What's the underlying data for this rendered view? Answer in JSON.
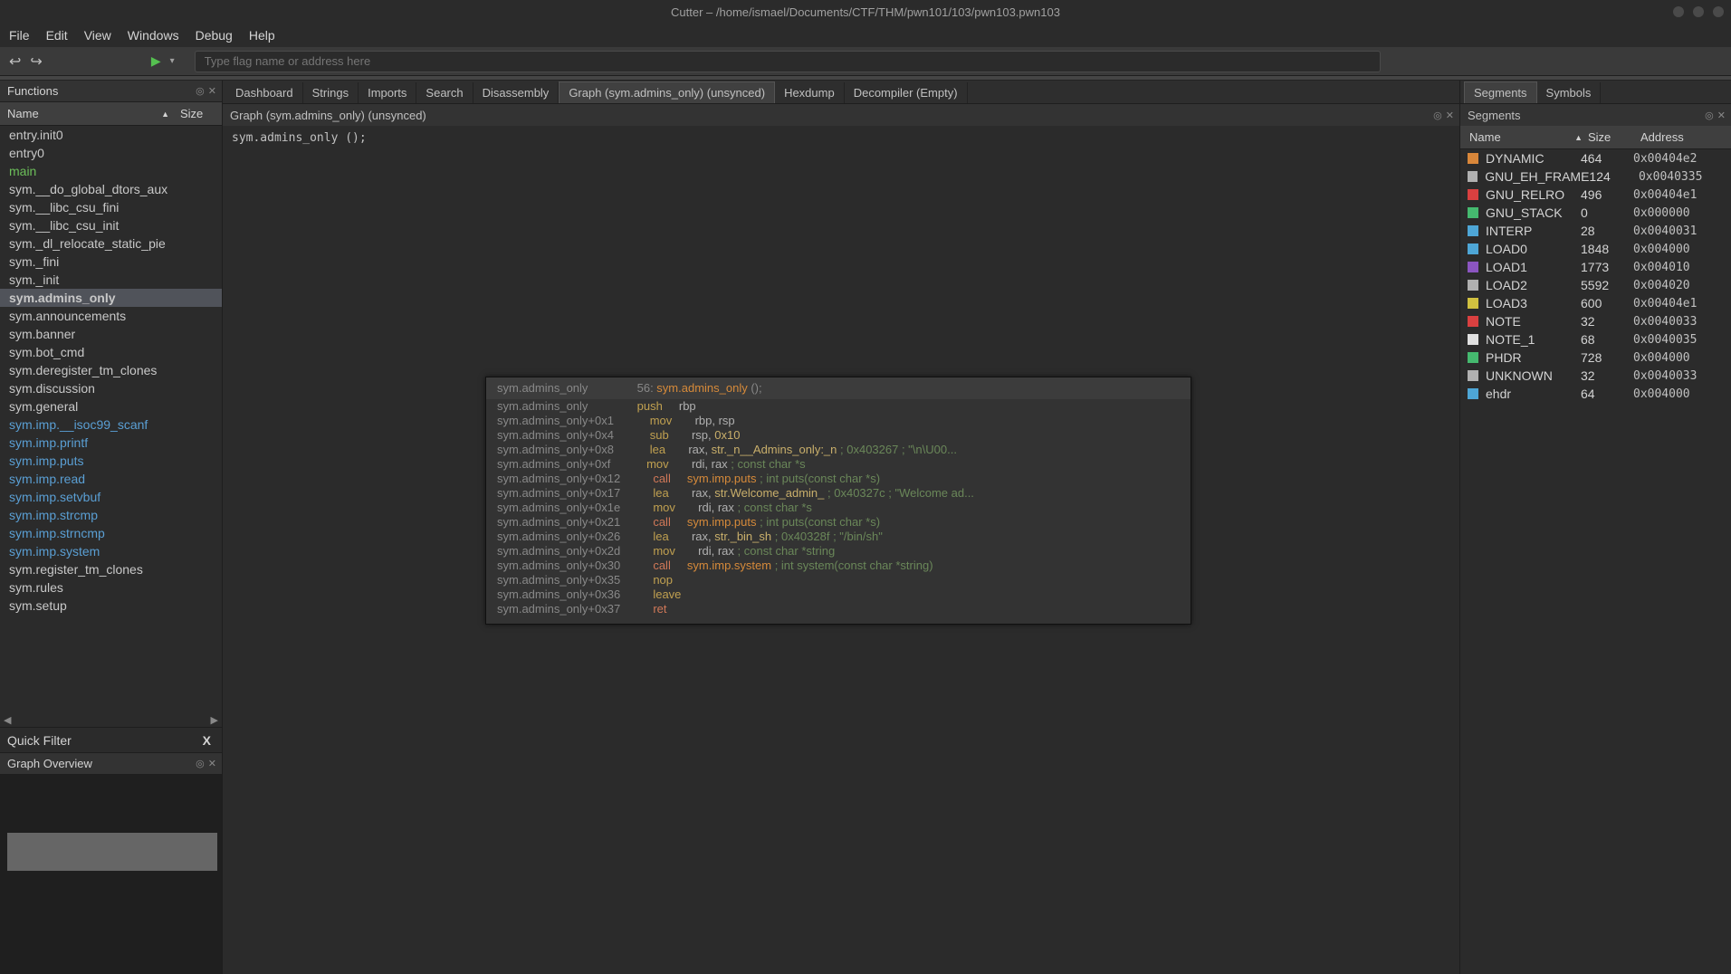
{
  "title": "Cutter – /home/ismael/Documents/CTF/THM/pwn101/103/pwn103.pwn103",
  "menu": {
    "file": "File",
    "edit": "Edit",
    "view": "View",
    "windows": "Windows",
    "debug": "Debug",
    "help": "Help"
  },
  "toolbar": {
    "search_placeholder": "Type flag name or address here"
  },
  "left": {
    "title": "Functions",
    "col_name": "Name",
    "col_size": "Size",
    "quick_filter": "Quick Filter",
    "graph_ov": "Graph Overview",
    "items": [
      {
        "label": "entry.init0",
        "style": ""
      },
      {
        "label": "entry0",
        "style": ""
      },
      {
        "label": "main",
        "style": "green"
      },
      {
        "label": "sym.__do_global_dtors_aux",
        "style": ""
      },
      {
        "label": "sym.__libc_csu_fini",
        "style": ""
      },
      {
        "label": "sym.__libc_csu_init",
        "style": ""
      },
      {
        "label": "sym._dl_relocate_static_pie",
        "style": ""
      },
      {
        "label": "sym._fini",
        "style": ""
      },
      {
        "label": "sym._init",
        "style": ""
      },
      {
        "label": "sym.admins_only",
        "style": "selected"
      },
      {
        "label": "sym.announcements",
        "style": ""
      },
      {
        "label": "sym.banner",
        "style": ""
      },
      {
        "label": "sym.bot_cmd",
        "style": ""
      },
      {
        "label": "sym.deregister_tm_clones",
        "style": ""
      },
      {
        "label": "sym.discussion",
        "style": ""
      },
      {
        "label": "sym.general",
        "style": ""
      },
      {
        "label": "sym.imp.__isoc99_scanf",
        "style": "blue"
      },
      {
        "label": "sym.imp.printf",
        "style": "blue"
      },
      {
        "label": "sym.imp.puts",
        "style": "blue"
      },
      {
        "label": "sym.imp.read",
        "style": "blue"
      },
      {
        "label": "sym.imp.setvbuf",
        "style": "blue"
      },
      {
        "label": "sym.imp.strcmp",
        "style": "blue"
      },
      {
        "label": "sym.imp.strncmp",
        "style": "blue"
      },
      {
        "label": "sym.imp.system",
        "style": "blue"
      },
      {
        "label": "sym.register_tm_clones",
        "style": ""
      },
      {
        "label": "sym.rules",
        "style": ""
      },
      {
        "label": "sym.setup",
        "style": ""
      }
    ]
  },
  "center": {
    "tabs": [
      {
        "label": "Dashboard",
        "active": false
      },
      {
        "label": "Strings",
        "active": false
      },
      {
        "label": "Imports",
        "active": false
      },
      {
        "label": "Search",
        "active": false
      },
      {
        "label": "Disassembly",
        "active": false
      },
      {
        "label": "Graph (sym.admins_only) (unsynced)",
        "active": true
      },
      {
        "label": "Hexdump",
        "active": false
      },
      {
        "label": "Decompiler (Empty)",
        "active": false
      }
    ],
    "subtitle": "Graph (sym.admins_only) (unsynced)",
    "sym_line": "sym.admins_only ();",
    "node": {
      "header_left": "sym.admins_only",
      "header_right_pre": "56: ",
      "header_right_fn": "sym.admins_only",
      "header_right_post": " ();",
      "lines": [
        {
          "addr": "sym.admins_only",
          "mnem": "push",
          "mnemc": "mnem",
          "ops": "   rbp",
          "cmt": ""
        },
        {
          "addr": "sym.admins_only+0x1",
          "mnem": "mov",
          "mnemc": "mnem",
          "ops": "    rbp, rsp",
          "cmt": ""
        },
        {
          "addr": "sym.admins_only+0x4",
          "mnem": "sub",
          "mnemc": "mnem",
          "ops": "    rsp, ",
          "lit": "0x10",
          "cmt": ""
        },
        {
          "addr": "sym.admins_only+0x8",
          "mnem": "lea",
          "mnemc": "mnem",
          "ops": "    rax, ",
          "str": "str._n__Admins_only:_n",
          "cmt": " ; 0x403267 ; \"\\n\\U00..."
        },
        {
          "addr": "sym.admins_only+0xf",
          "mnem": "mov",
          "mnemc": "mnem",
          "ops": "    rdi, rax ",
          "cmt": "; const char *s"
        },
        {
          "addr": "sym.admins_only+0x12",
          "mnem": "call",
          "mnemc": "mnem-call",
          "ops": "   ",
          "sym": "sym.imp.puts",
          "cmt": " ; int puts(const char *s)"
        },
        {
          "addr": "sym.admins_only+0x17",
          "mnem": "lea",
          "mnemc": "mnem",
          "ops": "    rax, ",
          "str": "str.Welcome_admin_",
          "cmt": " ; 0x40327c ; \"Welcome ad..."
        },
        {
          "addr": "sym.admins_only+0x1e",
          "mnem": "mov",
          "mnemc": "mnem",
          "ops": "    rdi, rax ",
          "cmt": "; const char *s"
        },
        {
          "addr": "sym.admins_only+0x21",
          "mnem": "call",
          "mnemc": "mnem-call",
          "ops": "   ",
          "sym": "sym.imp.puts",
          "cmt": " ; int puts(const char *s)"
        },
        {
          "addr": "sym.admins_only+0x26",
          "mnem": "lea",
          "mnemc": "mnem",
          "ops": "    rax, ",
          "str": "str._bin_sh",
          "cmt": " ; 0x40328f ; \"/bin/sh\""
        },
        {
          "addr": "sym.admins_only+0x2d",
          "mnem": "mov",
          "mnemc": "mnem",
          "ops": "    rdi, rax ",
          "cmt": "; const char *string"
        },
        {
          "addr": "sym.admins_only+0x30",
          "mnem": "call",
          "mnemc": "mnem-call",
          "ops": "   ",
          "sym": "sym.imp.system",
          "cmt": " ; int system(const char *string)"
        },
        {
          "addr": "sym.admins_only+0x35",
          "mnem": "nop",
          "mnemc": "mnem-nop",
          "ops": "",
          "cmt": ""
        },
        {
          "addr": "sym.admins_only+0x36",
          "mnem": "leave",
          "mnemc": "mnem",
          "ops": "",
          "cmt": ""
        },
        {
          "addr": "sym.admins_only+0x37",
          "mnem": "ret",
          "mnemc": "mnem-ret",
          "ops": "",
          "cmt": ""
        }
      ]
    }
  },
  "right": {
    "tabs": [
      {
        "label": "Segments",
        "active": true
      },
      {
        "label": "Symbols",
        "active": false
      }
    ],
    "subtitle": "Segments",
    "col_name": "Name",
    "col_size": "Size",
    "col_addr": "Address",
    "items": [
      {
        "color": "#d9873a",
        "name": "DYNAMIC",
        "size": "464",
        "addr": "0x00404e2"
      },
      {
        "color": "#b0b0b0",
        "name": "GNU_EH_FRAME",
        "size": "124",
        "addr": "0x0040335"
      },
      {
        "color": "#d94040",
        "name": "GNU_RELRO",
        "size": "496",
        "addr": "0x00404e1"
      },
      {
        "color": "#45b96f",
        "name": "GNU_STACK",
        "size": "0",
        "addr": "0x000000"
      },
      {
        "color": "#4ea6d6",
        "name": "INTERP",
        "size": "28",
        "addr": "0x0040031"
      },
      {
        "color": "#4ea6d6",
        "name": "LOAD0",
        "size": "1848",
        "addr": "0x004000"
      },
      {
        "color": "#8b55c0",
        "name": "LOAD1",
        "size": "1773",
        "addr": "0x004010"
      },
      {
        "color": "#b0b0b0",
        "name": "LOAD2",
        "size": "5592",
        "addr": "0x004020"
      },
      {
        "color": "#d0c040",
        "name": "LOAD3",
        "size": "600",
        "addr": "0x00404e1"
      },
      {
        "color": "#d94040",
        "name": "NOTE",
        "size": "32",
        "addr": "0x0040033"
      },
      {
        "color": "#e0e0e0",
        "name": "NOTE_1",
        "size": "68",
        "addr": "0x0040035"
      },
      {
        "color": "#45b96f",
        "name": "PHDR",
        "size": "728",
        "addr": "0x004000"
      },
      {
        "color": "#b0b0b0",
        "name": "UNKNOWN",
        "size": "32",
        "addr": "0x0040033"
      },
      {
        "color": "#4ea6d6",
        "name": "ehdr",
        "size": "64",
        "addr": "0x004000"
      }
    ]
  }
}
